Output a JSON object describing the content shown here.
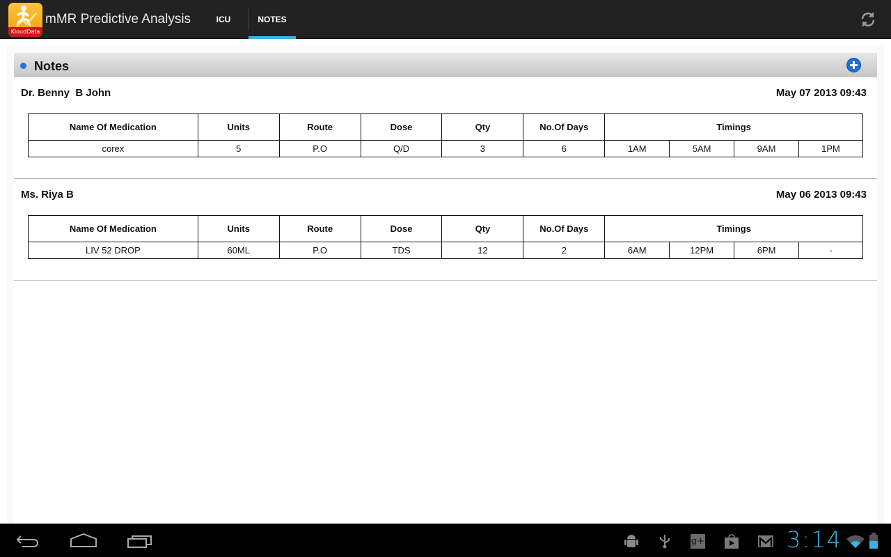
{
  "app": {
    "title": "mMR Predictive Analysis",
    "logo_label": "KloudData",
    "tabs": [
      {
        "label": "ICU",
        "selected": false
      },
      {
        "label": "NOTES",
        "selected": true
      }
    ],
    "accent_color": "#33b5e5"
  },
  "section": {
    "title": "Notes",
    "bullet_color": "#1a73e8"
  },
  "table_headers": [
    "Name Of Medication",
    "Units",
    "Route",
    "Dose",
    "Qty",
    "No.Of Days",
    "Timings"
  ],
  "notes": [
    {
      "doctor": "Dr. Benny  B John",
      "date": "May 07 2013 09:43",
      "medication": {
        "name": "corex",
        "units": "5",
        "route": "P.O",
        "dose": "Q/D",
        "qty": "3",
        "days": "6",
        "timings": [
          "1AM",
          "5AM",
          "9AM",
          "1PM"
        ]
      }
    },
    {
      "doctor": "Ms. Riya B",
      "date": "May 06 2013 09:43",
      "medication": {
        "name": "LIV 52 DROP",
        "units": "60ML",
        "route": "P.O",
        "dose": "TDS",
        "qty": "12",
        "days": "2",
        "timings": [
          "6AM",
          "12PM",
          "6PM",
          "-"
        ]
      }
    }
  ],
  "system_bar": {
    "time": "3:14",
    "nav_icons": [
      "back-icon",
      "home-icon",
      "recent-apps-icon"
    ],
    "status_icons": [
      "android-debug-icon",
      "usb-icon",
      "google-plus-icon",
      "play-store-icon",
      "gmail-icon",
      "wifi-icon",
      "battery-icon"
    ],
    "clock_color": "#33b5e5"
  }
}
